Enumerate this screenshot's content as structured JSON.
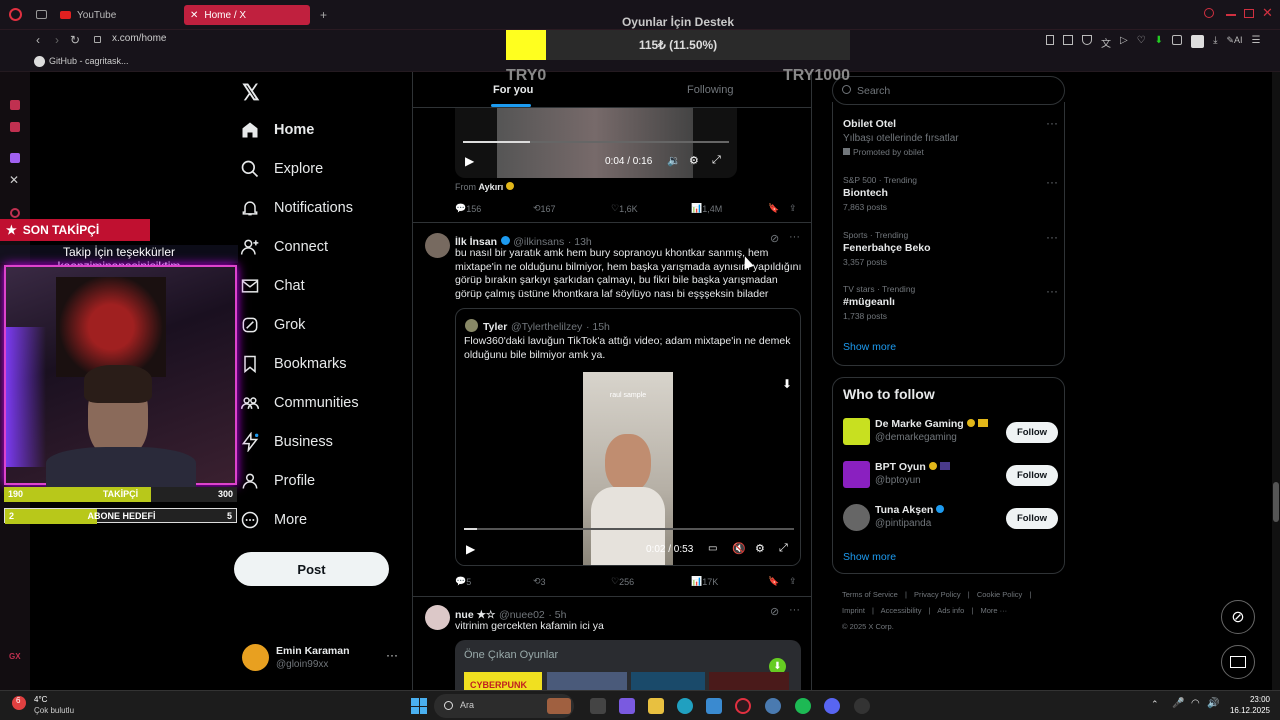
{
  "browser": {
    "tabs": [
      {
        "label": "YouTube"
      },
      {
        "label": "Home / X"
      }
    ],
    "url": "x.com/home",
    "bookmark": "GitHub - cagritask..."
  },
  "overlay": {
    "donation_title": "Oyunlar İçin Destek",
    "donation_amount": "115₺ (11.50%)",
    "donation_progress": 0.115,
    "donation_min": "TRY0",
    "donation_max": "TRY1000",
    "last_follower_label": "SON TAKİPÇİ",
    "follower_thanks": "Takip İçin teşekkürler kaanziminanasinisiktim",
    "followers_goal": {
      "current": "190",
      "label": "TAKİPÇİ",
      "target": "300",
      "progress": 0.63
    },
    "sub_goal": {
      "current": "2",
      "label": "ABONE HEDEFİ",
      "target": "5",
      "progress": 0.4
    }
  },
  "nav": {
    "items": [
      {
        "label": "Home",
        "icon": "home-icon"
      },
      {
        "label": "Explore",
        "icon": "search-icon"
      },
      {
        "label": "Notifications",
        "icon": "bell-icon"
      },
      {
        "label": "Connect",
        "icon": "person-plus-icon"
      },
      {
        "label": "Chat",
        "icon": "mail-icon"
      },
      {
        "label": "Grok",
        "icon": "grok-icon"
      },
      {
        "label": "Bookmarks",
        "icon": "bookmark-icon"
      },
      {
        "label": "Communities",
        "icon": "people-icon"
      },
      {
        "label": "Business",
        "icon": "lightning-icon"
      },
      {
        "label": "Profile",
        "icon": "person-icon"
      },
      {
        "label": "More",
        "icon": "more-circle-icon"
      }
    ],
    "post_label": "Post",
    "account": {
      "name": "Emin Karaman",
      "handle": "@gloin99xx"
    }
  },
  "timeline": {
    "tabs": [
      "For you",
      "Following"
    ],
    "top_video": {
      "time": "0:04 / 0:16",
      "from_label": "From",
      "from_name": "Aykırı",
      "progress": 0.25
    },
    "top_actions": {
      "replies": "156",
      "reposts": "167",
      "likes": "1,6K",
      "views": "1,4M"
    },
    "tweet1": {
      "name": "İlk İnsan",
      "handle": "@ilkinsans",
      "time": "· 13h",
      "text": "bu nasıl bir yaratık amk hem bury sopranoyu khontkar sanmış, hem mixtape'in ne olduğunu bilmiyor, hem başka yarışmada aynısını yapıldığını görüp bırakın şarkıyı şarkıdan çalmayı, bu fikri bile başka yarışmadan görüp çalmış üstüne khontkara laf söylüyo nası bi eşşşeksin bilader",
      "quote": {
        "name": "Tyler",
        "handle": "@Tylerthelilzey",
        "time": "· 15h",
        "text": "Flow360'daki lavuğun TikTok'a attığı video; adam mixtape'in ne demek olduğunu bile bilmiyor amk ya.",
        "video_caption": "raul sample",
        "video_time": "0:02 / 0:53",
        "progress": 0.04
      },
      "actions": {
        "replies": "5",
        "reposts": "3",
        "likes": "256",
        "views": "17K"
      }
    },
    "tweet2": {
      "name": "nue ★☆",
      "handle": "@nuee02",
      "time": "· 5h",
      "text": "vitrinim gercekten kafamin ici ya",
      "card_title": "Öne Çıkan Oyunlar",
      "card_game": "CYBERPUNK"
    }
  },
  "sidebar": {
    "search_placeholder": "Search",
    "trends": [
      {
        "meta": "",
        "name": "Obilet Otel",
        "sub": "Yılbaşı otellerinde fırsatlar",
        "count": "Promoted by obilet"
      },
      {
        "meta": "S&P 500 · Trending",
        "name": "Biontech",
        "count": "7,863 posts"
      },
      {
        "meta": "Sports · Trending",
        "name": "Fenerbahçe Beko",
        "count": "3,357 posts"
      },
      {
        "meta": "TV stars · Trending",
        "name": "#mügeanlı",
        "count": "1,738 posts"
      }
    ],
    "show_more": "Show more",
    "who_to_follow_title": "Who to follow",
    "who_to_follow": [
      {
        "name": "De Marke Gaming",
        "handle": "@demarkegaming",
        "avatar_color": "#c8e020"
      },
      {
        "name": "BPT Oyun",
        "handle": "@bptoyun",
        "avatar_color": "#8a20c0"
      },
      {
        "name": "Tuna Akşen",
        "handle": "@pintipanda",
        "avatar_color": "#666"
      }
    ],
    "follow_label": "Follow",
    "footer": [
      "Terms of Service",
      "|",
      "Privacy Policy",
      "|",
      "Cookie Policy",
      "|",
      "Imprint",
      "|",
      "Accessibility",
      "|",
      "Ads info",
      "|",
      "More ···",
      "© 2025 X Corp."
    ]
  },
  "taskbar": {
    "weather_temp": "4°C",
    "weather_desc": "Çok bulutlu",
    "weather_badge": "6",
    "search_placeholder": "Ara",
    "time": "23:00",
    "date": "16.12.2025"
  },
  "colors": {
    "accent": "#1d9bf0",
    "tab_active": "#c0203e",
    "donation": "#ffff1f",
    "goal": "#b8c81a"
  }
}
